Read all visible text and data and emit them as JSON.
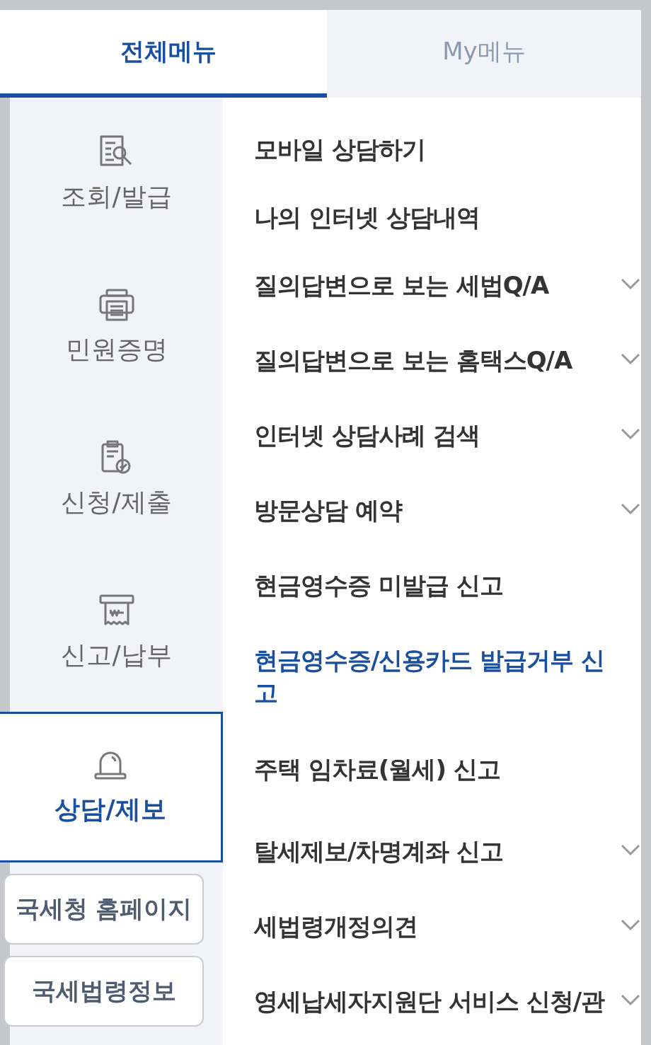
{
  "tabs": [
    {
      "label": "전체메뉴",
      "selected": true
    },
    {
      "label": "My메뉴",
      "selected": false
    }
  ],
  "categories": [
    {
      "label": "조회/발급",
      "selected": false
    },
    {
      "label": "민원증명",
      "selected": false
    },
    {
      "label": "신청/제출",
      "selected": false
    },
    {
      "label": "신고/납부",
      "selected": false
    },
    {
      "label": "상담/제보",
      "selected": true
    }
  ],
  "links": [
    "국세청 홈페이지",
    "국세법령정보"
  ],
  "menu_items": [
    {
      "label": "모바일 상담하기",
      "selected": false
    },
    {
      "label": "나의 인터넷 상담내역",
      "selected": false
    },
    {
      "label": "질의답변으로 보는 세법Q/A",
      "selected": false,
      "expanded": false
    },
    {
      "label": "질의답변으로 보는 홈택스Q/A",
      "selected": false,
      "expanded": false
    },
    {
      "label": "인터넷 상담사례 검색",
      "selected": false,
      "expanded": false
    },
    {
      "label": "방문상담 예약",
      "selected": false,
      "expanded": false
    },
    {
      "label": "현금영수증 미발급 신고",
      "selected": false
    },
    {
      "label": "현금영수증/신용카드 발급거부 신고",
      "selected": true
    },
    {
      "label": "주택 임차료(월세) 신고",
      "selected": false
    },
    {
      "label": "탈세제보/차명계좌 신고",
      "selected": false,
      "expanded": false
    },
    {
      "label": "세법령개정의견",
      "selected": false,
      "expanded": false
    },
    {
      "label": "영세납세자지원단 서비스 신청/관",
      "selected": false,
      "expanded": false
    }
  ]
}
